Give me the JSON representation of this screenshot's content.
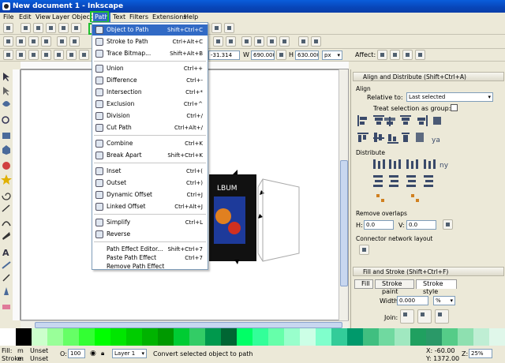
{
  "window": {
    "title": "New document 1 - Inkscape"
  },
  "menubar": [
    "File",
    "Edit",
    "View",
    "Layer",
    "Object",
    "Path",
    "Text",
    "Filters",
    "Extensions",
    "Help"
  ],
  "path_menu": {
    "items": [
      {
        "label": "Object to Path",
        "shortcut": "Shift+Ctrl+C",
        "selected": true,
        "icon": "object-to-path-icon"
      },
      {
        "label": "Stroke to Path",
        "shortcut": "Ctrl+Alt+C",
        "icon": "stroke-to-path-icon"
      },
      {
        "label": "Trace Bitmap...",
        "shortcut": "Shift+Alt+B",
        "icon": "trace-bitmap-icon"
      },
      {
        "label": "Union",
        "shortcut": "Ctrl++",
        "icon": "union-icon"
      },
      {
        "label": "Difference",
        "shortcut": "Ctrl+-",
        "icon": "difference-icon"
      },
      {
        "label": "Intersection",
        "shortcut": "Ctrl+*",
        "icon": "intersection-icon"
      },
      {
        "label": "Exclusion",
        "shortcut": "Ctrl+^",
        "icon": "exclusion-icon"
      },
      {
        "label": "Division",
        "shortcut": "Ctrl+/",
        "icon": "division-icon"
      },
      {
        "label": "Cut Path",
        "shortcut": "Ctrl+Alt+/",
        "icon": "cut-path-icon"
      },
      {
        "label": "Combine",
        "shortcut": "Ctrl+K",
        "icon": "combine-icon"
      },
      {
        "label": "Break Apart",
        "shortcut": "Shift+Ctrl+K",
        "icon": "break-apart-icon"
      },
      {
        "label": "Inset",
        "shortcut": "Ctrl+(",
        "icon": "inset-icon"
      },
      {
        "label": "Outset",
        "shortcut": "Ctrl+)",
        "icon": "outset-icon"
      },
      {
        "label": "Dynamic Offset",
        "shortcut": "Ctrl+J",
        "icon": "dynamic-offset-icon"
      },
      {
        "label": "Linked Offset",
        "shortcut": "Ctrl+Alt+J",
        "icon": "linked-offset-icon"
      },
      {
        "label": "Simplify",
        "shortcut": "Ctrl+L",
        "icon": "simplify-icon"
      },
      {
        "label": "Reverse",
        "shortcut": "",
        "icon": "reverse-icon"
      },
      {
        "label": "Path Effect Editor...",
        "shortcut": "Shift+Ctrl+7",
        "icon": ""
      },
      {
        "label": "Paste Path Effect",
        "shortcut": "Ctrl+7",
        "icon": ""
      },
      {
        "label": "Remove Path Effect",
        "shortcut": "",
        "icon": ""
      }
    ]
  },
  "toolbar": {
    "x_value": "-31.314",
    "w_label": "W",
    "w_value": "690.000",
    "h_label": "H",
    "h_value": "630.000",
    "unit": "px",
    "affect_label": "Affect:"
  },
  "align_panel": {
    "title": "Align and Distribute (Shift+Ctrl+A)",
    "align_label": "Align",
    "relative_to_label": "Relative to:",
    "relative_to_value": "Last selected",
    "group_label": "Treat selection as group:",
    "distribute_label": "Distribute",
    "remove_overlaps_label": "Remove overlaps",
    "h_label": "H:",
    "h_value": "0.0",
    "v_label": "V:",
    "v_value": "0.0",
    "connector_label": "Connector network layout"
  },
  "fill_panel": {
    "title": "Fill and Stroke (Shift+Ctrl+F)",
    "tabs": [
      "Fill",
      "Stroke paint",
      "Stroke style"
    ],
    "width_label": "Width:",
    "width_value": "0.000",
    "width_unit": "%",
    "join_label": "Join:"
  },
  "canvas": {
    "album_text": "LBUM"
  },
  "status": {
    "fill_label": "Fill:",
    "fill_value": "m",
    "fill_state": "Unset",
    "stroke_label": "Stroke:",
    "stroke_value": "m",
    "stroke_state": "Unset",
    "opacity_label": "O:",
    "opacity_value": "100",
    "layer": "Layer 1",
    "message": "Convert selected object to path",
    "x_coord": "X: -60.00",
    "y_coord": "Y: 1372.00",
    "z_label": "Z:",
    "zoom": "25%"
  },
  "palette_colors": [
    "#ffffff",
    "#000000",
    "#ccffcc",
    "#99ff99",
    "#66ff66",
    "#33ff33",
    "#00ff00",
    "#00e600",
    "#00cc00",
    "#00b300",
    "#009900",
    "#00cc33",
    "#33cc66",
    "#00994d",
    "#006633",
    "#00ff66",
    "#33ff99",
    "#66ffaa",
    "#99ffcc",
    "#ccffe6",
    "#80ffcc",
    "#33cc99",
    "#00996b",
    "#40bf80",
    "#70d9a0",
    "#a0e8c0",
    "#20a060",
    "#2a9968",
    "#55cc88",
    "#8ee0b0",
    "#bfeed4",
    "#e0f7ea"
  ]
}
